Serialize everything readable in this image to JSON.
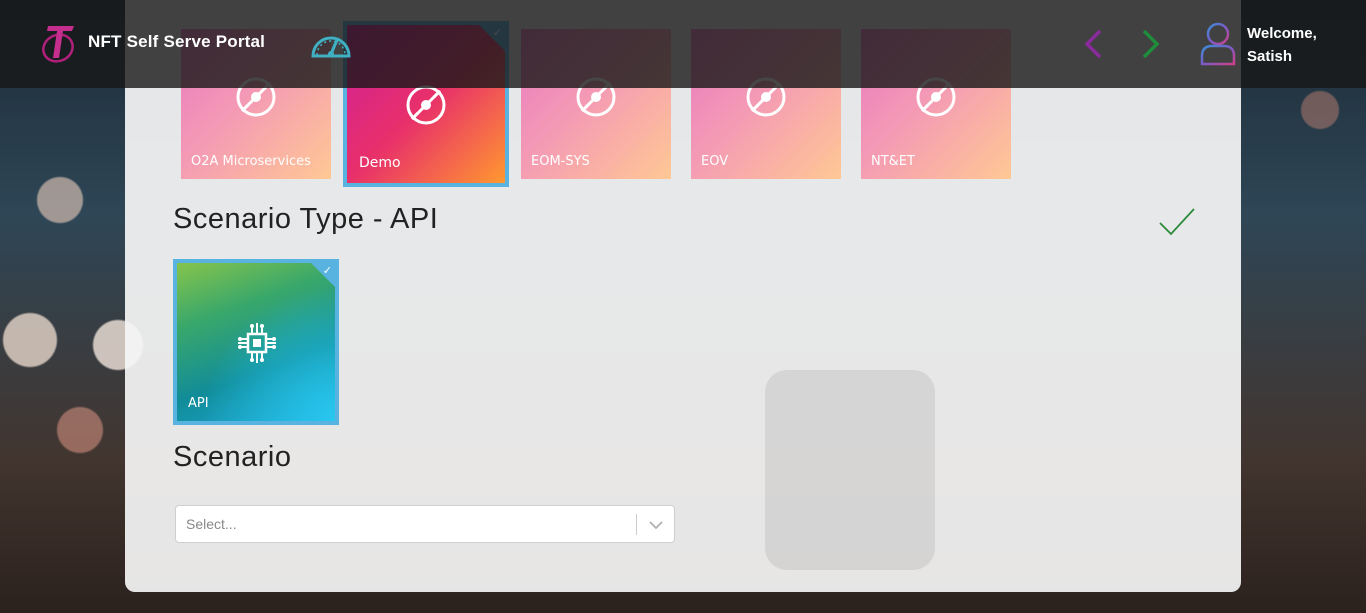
{
  "header": {
    "app_title": "NFT Self Serve Portal",
    "welcome_line1": "Welcome,",
    "welcome_line2": "Satish",
    "logo_icon": "telstra-logo",
    "dashboard_icon": "speedometer-icon",
    "prev_icon": "chevron-left-icon",
    "next_icon": "chevron-right-icon",
    "user_icon": "user-icon",
    "colors": {
      "prev": "#8b2a9c",
      "next": "#1e8c3a",
      "accent": "#58b3e0"
    }
  },
  "applications": {
    "items": [
      {
        "label": "O2A Microservices",
        "icon": "satellite-icon",
        "selected": false
      },
      {
        "label": "Demo",
        "icon": "satellite-icon",
        "selected": true
      },
      {
        "label": "EOM-SYS",
        "icon": "satellite-icon",
        "selected": false
      },
      {
        "label": "EOV",
        "icon": "satellite-icon",
        "selected": false
      },
      {
        "label": "NT&ET",
        "icon": "satellite-icon",
        "selected": false
      }
    ]
  },
  "scenario_type": {
    "title": "Scenario Type - API",
    "done_icon": "checkmark-icon",
    "items": [
      {
        "label": "API",
        "icon": "circuit-chip-icon",
        "selected": true
      }
    ]
  },
  "scenario": {
    "title": "Scenario",
    "select_placeholder": "Select...",
    "dropdown_icon": "chevron-down-icon"
  }
}
